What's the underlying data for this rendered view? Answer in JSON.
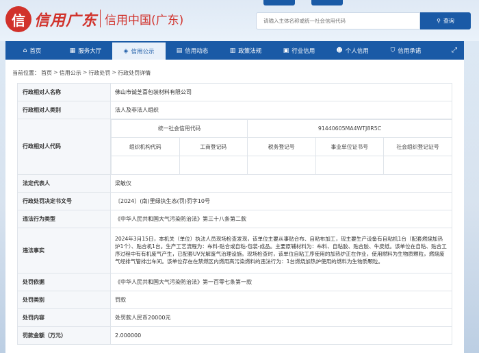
{
  "header": {
    "logo_glyph": "信",
    "logo_script": "信用广东",
    "site_name": "信用中国(广东)",
    "search_placeholder": "请输入主体名称或统一社会信用代码",
    "search_button": "查询"
  },
  "nav": {
    "items": [
      {
        "label": "首页",
        "icon": "home-icon",
        "glyph": "⌂"
      },
      {
        "label": "服务大厅",
        "icon": "grid-icon",
        "glyph": "▦"
      },
      {
        "label": "信用公示",
        "icon": "megaphone-icon",
        "glyph": "◈"
      },
      {
        "label": "信用动态",
        "icon": "news-icon",
        "glyph": "▤"
      },
      {
        "label": "政策法规",
        "icon": "book-icon",
        "glyph": "▥"
      },
      {
        "label": "行业信用",
        "icon": "briefcase-icon",
        "glyph": "▣"
      },
      {
        "label": "个人信用",
        "icon": "user-icon",
        "glyph": "☻"
      },
      {
        "label": "信用承诺",
        "icon": "shield-icon",
        "glyph": "⛉"
      }
    ],
    "active_index": 2,
    "expand_glyph": "⤢"
  },
  "breadcrumb": {
    "prefix": "当前位置：",
    "items": [
      "首页",
      "信用公示",
      "行政处罚",
      "行政处罚详情"
    ]
  },
  "detail": {
    "rows": {
      "name_label": "行政相对人名称",
      "name_value": "佛山市诚芝喜包装材料有限公司",
      "category_label": "行政相对人类别",
      "category_value": "法人及非法人组织",
      "code_label": "行政相对人代码",
      "code_headers_top": [
        "统一社会信用代码",
        "91440605MA4WTJ8R5C"
      ],
      "code_headers": [
        "组织机构代码",
        "工商登记码",
        "税务登记号",
        "事业单位证书号",
        "社会组织登记证号"
      ],
      "code_values": [
        "",
        "",
        "",
        "",
        ""
      ],
      "rep_label": "法定代表人",
      "rep_value": "梁敏仪",
      "doc_label": "行政处罚决定书文号",
      "doc_value": "〔2024〕(南)里绿执生态(罚)罚字10号",
      "violation_type_label": "违法行为类型",
      "violation_type_value": "《中华人民共和国大气污染防治法》第三十八条第二款",
      "facts_label": "违法事实",
      "facts_value": "2024年3月15日，本机关（单位）执法人员现场检查发现，该单位主要从事贴合布、自粘布加工，现主要生产设备有自粘机1台（配套燃烧加热炉1个）、贴合机1台。生产工艺流程为：布料-贴合或自粘-包装-成品。主要原辅材料为：布料、自粘胶、贴合胶、牛皮纸。该单位在自粘、贴合工序过程中有有机废气产生，已配套UV光解废气治理设施。现场检查时，该单位自粘工序使用的加热炉正在作业，使用燃料为生物质颗粒，燃烧废气经排气管排出车间。该单位存在在禁燃区内燃用高污染燃料的违法行为：1台燃烧加热炉使用的燃料为生物质颗粒。",
      "basis_label": "处罚依据",
      "basis_value": "《中华人民共和国大气污染防治法》第一百零七条第一款",
      "ptype_label": "处罚类别",
      "ptype_value": "罚款",
      "content_label": "处罚内容",
      "content_value": "处罚款人民币20000元",
      "amount_label": "罚款金额（万元）",
      "amount_value": "2.000000"
    }
  },
  "colors": {
    "brand_red": "#d1322b",
    "nav_blue": "#1a5aa6"
  }
}
